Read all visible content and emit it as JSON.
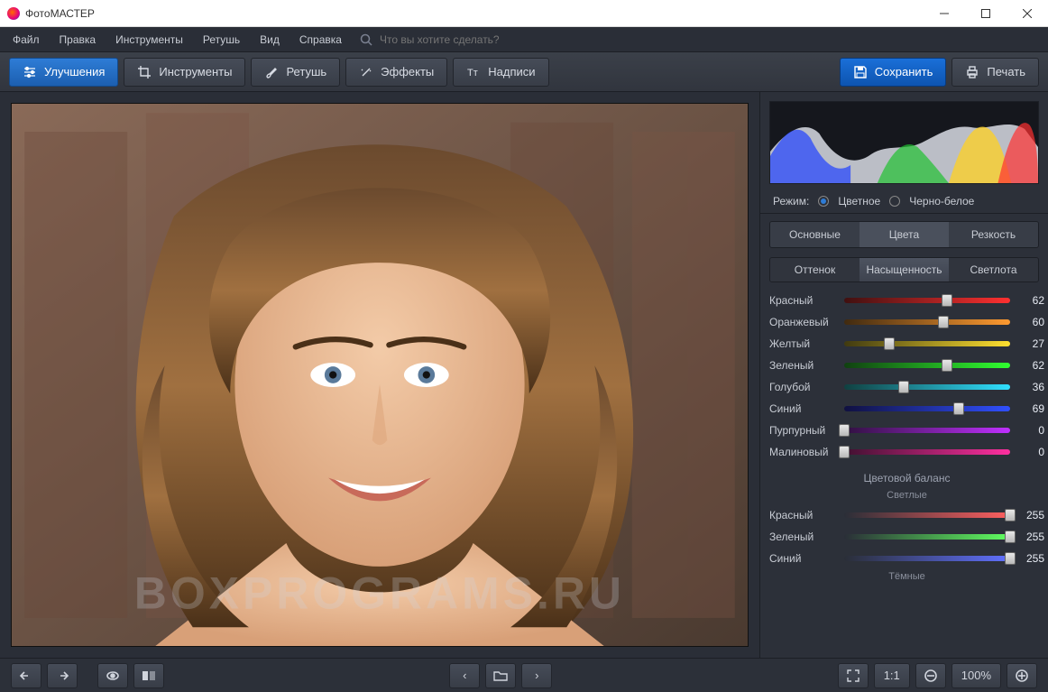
{
  "app_title": "ФотоМАСТЕР",
  "menu": {
    "items": [
      "Файл",
      "Правка",
      "Инструменты",
      "Ретушь",
      "Вид",
      "Справка"
    ],
    "search_placeholder": "Что вы хотите сделать?"
  },
  "toolbar": {
    "enhance": "Улучшения",
    "tools": "Инструменты",
    "retouch": "Ретушь",
    "effects": "Эффекты",
    "text": "Надписи",
    "save": "Сохранить",
    "print": "Печать"
  },
  "right": {
    "mode_label": "Режим:",
    "mode_color": "Цветное",
    "mode_bw": "Черно-белое",
    "tabs": [
      "Основные",
      "Цвета",
      "Резкость"
    ],
    "subtabs": [
      "Оттенок",
      "Насыщенность",
      "Светлота"
    ],
    "sliders": [
      {
        "label": "Красный",
        "value": 62,
        "color1": "#401010",
        "color2": "#ff3030"
      },
      {
        "label": "Оранжевый",
        "value": 60,
        "color1": "#402a10",
        "color2": "#ff9a30"
      },
      {
        "label": "Желтый",
        "value": 27,
        "color1": "#403a10",
        "color2": "#ffe030"
      },
      {
        "label": "Зеленый",
        "value": 62,
        "color1": "#104010",
        "color2": "#30ff30"
      },
      {
        "label": "Голубой",
        "value": 36,
        "color1": "#104040",
        "color2": "#30e0ff"
      },
      {
        "label": "Синий",
        "value": 69,
        "color1": "#101040",
        "color2": "#3050ff"
      },
      {
        "label": "Пурпурный",
        "value": 0,
        "color1": "#301040",
        "color2": "#c030ff"
      },
      {
        "label": "Малиновый",
        "value": 0,
        "color1": "#401030",
        "color2": "#ff30a0"
      }
    ],
    "balance_title": "Цветовой баланс",
    "balance_light": "Светлые",
    "balance_dark": "Тёмные",
    "balance_sliders": [
      {
        "label": "Красный",
        "value": 255,
        "color1": "#2a2e37",
        "color2": "#ff6060"
      },
      {
        "label": "Зеленый",
        "value": 255,
        "color1": "#2a2e37",
        "color2": "#60ff60"
      },
      {
        "label": "Синий",
        "value": 255,
        "color1": "#2a2e37",
        "color2": "#6070ff"
      }
    ]
  },
  "bottom": {
    "ratio": "1:1",
    "zoom": "100%"
  },
  "watermark": "BOXPROGRAMS.RU"
}
